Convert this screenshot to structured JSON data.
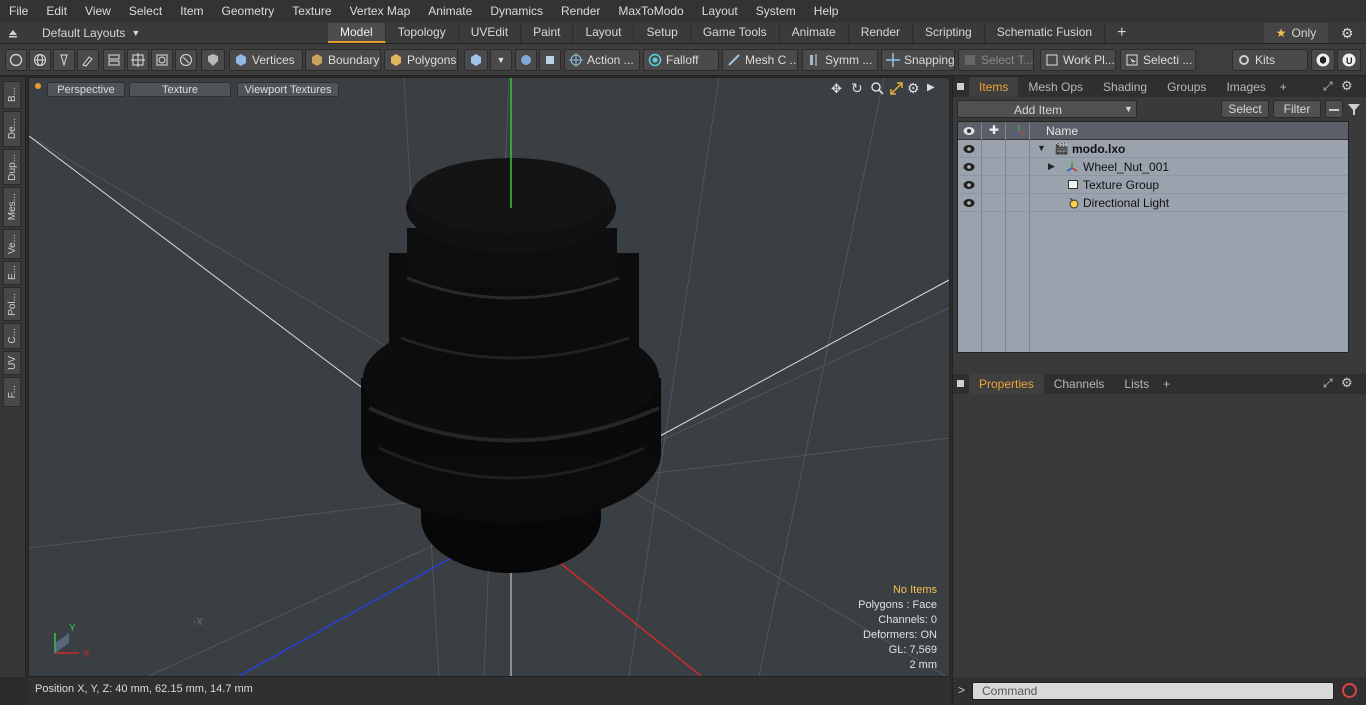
{
  "menubar": [
    "File",
    "Edit",
    "View",
    "Select",
    "Item",
    "Geometry",
    "Texture",
    "Vertex Map",
    "Animate",
    "Dynamics",
    "Render",
    "MaxToModo",
    "Layout",
    "System",
    "Help"
  ],
  "layouts": {
    "label": "Default Layouts"
  },
  "layout_tabs": [
    "Model",
    "Topology",
    "UVEdit",
    "Paint",
    "Layout",
    "Setup",
    "Game Tools",
    "Animate",
    "Render",
    "Scripting",
    "Schematic Fusion"
  ],
  "layout_active": "Model",
  "only_label": "Only",
  "toolbar": {
    "vertices": "Vertices",
    "boundary": "Boundary",
    "polygons": "Polygons",
    "action": "Action ...",
    "falloff": "Falloff",
    "mesh": "Mesh C ...",
    "symm": "Symm ...",
    "snapping": "Snapping",
    "select_t": "Select T...",
    "work_pl": "Work Pl...",
    "selecti": "Selecti ...",
    "kits": "Kits"
  },
  "left_tabs": [
    "B...",
    "De...",
    "Dup...",
    "Mes...",
    "Ve...",
    "E...",
    "Pol...",
    "C...",
    "UV",
    "F..."
  ],
  "viewport": {
    "perspective": "Perspective",
    "texture": "Texture",
    "viewport_textures": "Viewport Textures",
    "info": {
      "no_items": "No Items",
      "polygons": "Polygons : Face",
      "channels": "Channels: 0",
      "deformers": "Deformers: ON",
      "gl": "GL: 7,569",
      "scale": "2 mm"
    },
    "axis_y": "Y",
    "axis_x": "X",
    "axis_minus_x": "-X"
  },
  "status": {
    "position": "Position X, Y, Z:  40 mm, 62.15 mm, 14.7 mm"
  },
  "items_panel": {
    "tabs": [
      "Items",
      "Mesh Ops",
      "Shading",
      "Groups",
      "Images"
    ],
    "active": "Items",
    "add_item": "Add Item",
    "select": "Select",
    "filter": "Filter",
    "name_col": "Name",
    "tree": [
      {
        "label": "modo.lxo",
        "depth": 0,
        "bold": true
      },
      {
        "label": "Wheel_Nut_001",
        "depth": 1,
        "bold": false
      },
      {
        "label": "Texture Group",
        "depth": 1,
        "bold": false
      },
      {
        "label": "Directional Light",
        "depth": 1,
        "bold": false
      }
    ]
  },
  "properties_panel": {
    "tabs": [
      "Properties",
      "Channels",
      "Lists"
    ],
    "active": "Properties"
  },
  "command": {
    "placeholder": "Command"
  },
  "colors": {
    "accent": "#e39a2e",
    "tree_bg": "#9aa3ad",
    "viewport_bg": "#3a3f44"
  }
}
